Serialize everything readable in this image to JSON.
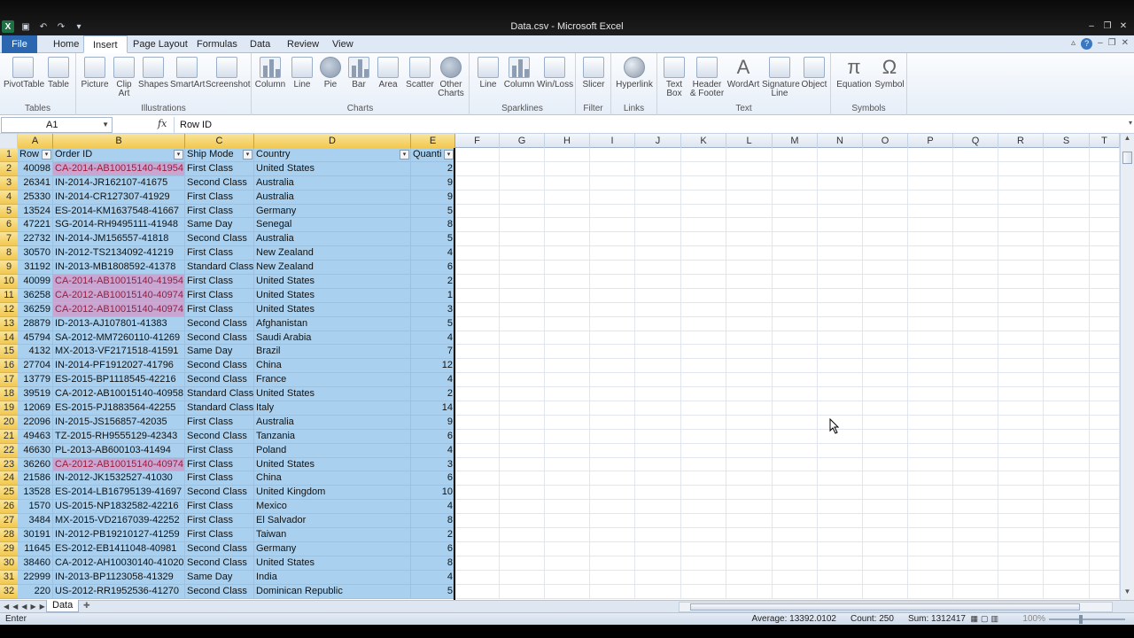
{
  "window": {
    "title": "Data.csv  -  Microsoft Excel"
  },
  "ribbon_tabs": [
    "File",
    "Home",
    "Insert",
    "Page Layout",
    "Formulas",
    "Data",
    "Review",
    "View"
  ],
  "ribbon": {
    "groups": [
      "Tables",
      "Illustrations",
      "Charts",
      "Sparklines",
      "Filter",
      "Links",
      "Text",
      "Symbols"
    ],
    "buttons": {
      "pivottable": "PivotTable",
      "table": "Table",
      "picture": "Picture",
      "clipart": "Clip Art",
      "shapes": "Shapes",
      "smartart": "SmartArt",
      "screenshot": "Screenshot",
      "column": "Column",
      "line": "Line",
      "pie": "Pie",
      "bar": "Bar",
      "area": "Area",
      "scatter": "Scatter",
      "other": "Other Charts",
      "sp_line": "Line",
      "sp_column": "Column",
      "sp_winloss": "Win/Loss",
      "slicer": "Slicer",
      "hyperlink": "Hyperlink",
      "textbox": "Text Box",
      "header": "Header & Footer",
      "wordart": "WordArt",
      "signature": "Signature Line",
      "object": "Object",
      "equation": "Equation",
      "symbol": "Symbol"
    }
  },
  "formula_bar": {
    "name_box": "A1",
    "fx": "fx",
    "content": "Row ID"
  },
  "columns": [
    "A",
    "B",
    "C",
    "D",
    "E",
    "F",
    "G",
    "H",
    "I",
    "J",
    "K",
    "L",
    "M",
    "N",
    "O",
    "P",
    "Q",
    "R",
    "S",
    "T"
  ],
  "table_headers": [
    "Row",
    "Order ID",
    "Ship Mode",
    "Country",
    "Quanti"
  ],
  "rows": [
    [
      "40098",
      "CA-2014-AB10015140-41954",
      "First Class",
      "United States",
      "2"
    ],
    [
      "26341",
      "IN-2014-JR162107-41675",
      "Second Class",
      "Australia",
      "9"
    ],
    [
      "25330",
      "IN-2014-CR127307-41929",
      "First Class",
      "Australia",
      "9"
    ],
    [
      "13524",
      "ES-2014-KM1637548-41667",
      "First Class",
      "Germany",
      "5"
    ],
    [
      "47221",
      "SG-2014-RH9495111-41948",
      "Same Day",
      "Senegal",
      "8"
    ],
    [
      "22732",
      "IN-2014-JM156557-41818",
      "Second Class",
      "Australia",
      "5"
    ],
    [
      "30570",
      "IN-2012-TS2134092-41219",
      "First Class",
      "New Zealand",
      "4"
    ],
    [
      "31192",
      "IN-2013-MB1808592-41378",
      "Standard Class",
      "New Zealand",
      "6"
    ],
    [
      "40099",
      "CA-2014-AB10015140-41954",
      "First Class",
      "United States",
      "2"
    ],
    [
      "36258",
      "CA-2012-AB10015140-40974",
      "First Class",
      "United States",
      "1"
    ],
    [
      "36259",
      "CA-2012-AB10015140-40974",
      "First Class",
      "United States",
      "3"
    ],
    [
      "28879",
      "ID-2013-AJ107801-41383",
      "Second Class",
      "Afghanistan",
      "5"
    ],
    [
      "45794",
      "SA-2012-MM7260110-41269",
      "Second Class",
      "Saudi Arabia",
      "4"
    ],
    [
      "4132",
      "MX-2013-VF2171518-41591",
      "Same Day",
      "Brazil",
      "7"
    ],
    [
      "27704",
      "IN-2014-PF1912027-41796",
      "Second Class",
      "China",
      "12"
    ],
    [
      "13779",
      "ES-2015-BP1118545-42216",
      "Second Class",
      "France",
      "4"
    ],
    [
      "39519",
      "CA-2012-AB10015140-40958",
      "Standard Class",
      "United States",
      "2"
    ],
    [
      "12069",
      "ES-2015-PJ1883564-42255",
      "Standard Class",
      "Italy",
      "14"
    ],
    [
      "22096",
      "IN-2015-JS156857-42035",
      "First Class",
      "Australia",
      "9"
    ],
    [
      "49463",
      "TZ-2015-RH9555129-42343",
      "Second Class",
      "Tanzania",
      "6"
    ],
    [
      "46630",
      "PL-2013-AB600103-41494",
      "First Class",
      "Poland",
      "4"
    ],
    [
      "36260",
      "CA-2012-AB10015140-40974",
      "First Class",
      "United States",
      "3"
    ],
    [
      "21586",
      "IN-2012-JK1532527-41030",
      "First Class",
      "China",
      "6"
    ],
    [
      "13528",
      "ES-2014-LB16795139-41697",
      "Second Class",
      "United Kingdom",
      "10"
    ],
    [
      "1570",
      "US-2015-NP1832582-42216",
      "First Class",
      "Mexico",
      "4"
    ],
    [
      "3484",
      "MX-2015-VD2167039-42252",
      "First Class",
      "El Salvador",
      "8"
    ],
    [
      "30191",
      "IN-2012-PB19210127-41259",
      "First Class",
      "Taiwan",
      "2"
    ],
    [
      "11645",
      "ES-2012-EB1411048-40981",
      "Second Class",
      "Germany",
      "6"
    ],
    [
      "38460",
      "CA-2012-AH10030140-41020",
      "Second Class",
      "United States",
      "8"
    ],
    [
      "22999",
      "IN-2013-BP1123058-41329",
      "Same Day",
      "India",
      "4"
    ],
    [
      "220",
      "US-2012-RR1952536-41270",
      "Second Class",
      "Dominican Republic",
      "5"
    ]
  ],
  "duplicate_row_indices": [
    0,
    8,
    9,
    10,
    21
  ],
  "sheet_tab": "Data",
  "status": {
    "mode": "Enter",
    "average": "Average: 13392.0102",
    "count": "Count: 250",
    "sum": "Sum: 1312417",
    "zoom": "100%"
  },
  "colors": {
    "selection": "#a9d1ef",
    "duplicate_fill": "#c9a6d2",
    "duplicate_text": "#9c1b3a",
    "header_highlight": "#f2c84f",
    "file_tab": "#2a67b0"
  }
}
